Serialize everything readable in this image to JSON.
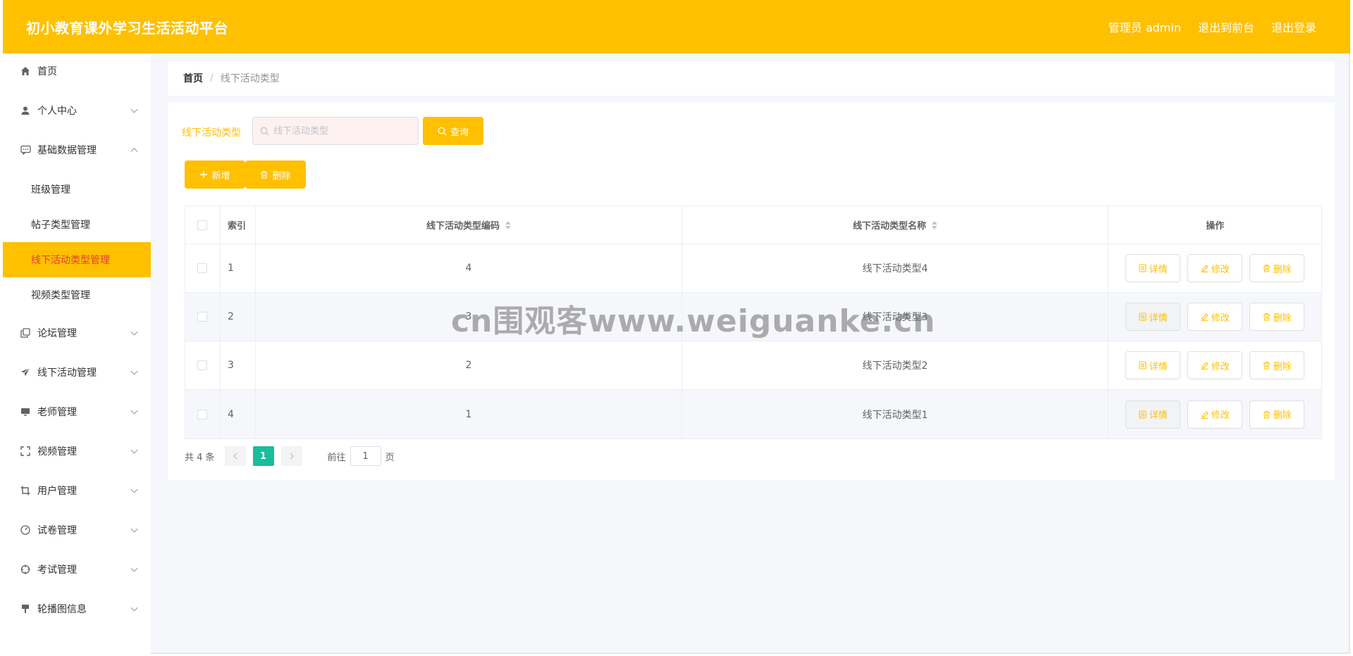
{
  "header": {
    "app_title": "初小教育课外学习生活活动平台",
    "user_label": "管理员 admin",
    "link_frontend": "退出到前台",
    "link_logout": "退出登录"
  },
  "sidebar": {
    "items": [
      {
        "label": "首页",
        "icon": "home-icon"
      },
      {
        "label": "个人中心",
        "icon": "user-icon"
      },
      {
        "label": "基础数据管理",
        "icon": "chat-icon",
        "expanded": true
      },
      {
        "label": "论坛管理",
        "icon": "copy-icon"
      },
      {
        "label": "线下活动管理",
        "icon": "send-icon"
      },
      {
        "label": "老师管理",
        "icon": "monitor-icon"
      },
      {
        "label": "视频管理",
        "icon": "fullscreen-icon"
      },
      {
        "label": "用户管理",
        "icon": "crop-icon"
      },
      {
        "label": "试卷管理",
        "icon": "gauge-icon"
      },
      {
        "label": "考试管理",
        "icon": "target-icon"
      },
      {
        "label": "轮播图信息",
        "icon": "brush-icon"
      }
    ],
    "sub_items": [
      {
        "label": "班级管理"
      },
      {
        "label": "帖子类型管理"
      },
      {
        "label": "线下活动类型管理",
        "active": true
      },
      {
        "label": "视频类型管理"
      }
    ]
  },
  "breadcrumb": {
    "home": "首页",
    "separator": "/",
    "current": "线下活动类型"
  },
  "search": {
    "label": "线下活动类型",
    "placeholder": "线下活动类型",
    "query_button": "查询"
  },
  "actions": {
    "add_button": "新增",
    "delete_button": "删除"
  },
  "table": {
    "headers": {
      "index": "索引",
      "code": "线下活动类型编码",
      "name": "线下活动类型名称",
      "ops": "操作"
    },
    "op_labels": {
      "detail": "详情",
      "edit": "修改",
      "delete": "删除"
    },
    "rows": [
      {
        "index": "1",
        "code": "4",
        "name": "线下活动类型4"
      },
      {
        "index": "2",
        "code": "3",
        "name": "线下活动类型3"
      },
      {
        "index": "3",
        "code": "2",
        "name": "线下活动类型2"
      },
      {
        "index": "4",
        "code": "1",
        "name": "线下活动类型1"
      }
    ]
  },
  "pagination": {
    "total": "共 4 条",
    "current_page": "1",
    "goto_label": "前往",
    "goto_value": "1",
    "page_suffix": "页"
  },
  "watermark": "cn围观客www.weiguanke.cn",
  "colors": {
    "primary": "#ffc000",
    "active_text": "#e4393c",
    "page_active": "#1abc9c"
  }
}
